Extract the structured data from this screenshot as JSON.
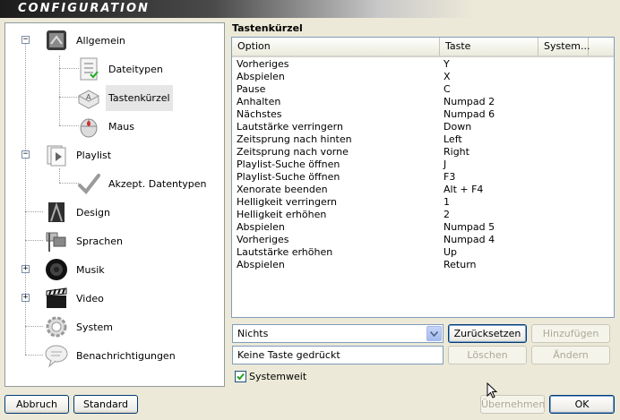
{
  "window": {
    "title": "CONFIGURATION"
  },
  "tree": {
    "items": [
      {
        "label": "Allgemein",
        "icon": "settings-panel-icon",
        "expander": "−"
      },
      {
        "label": "Dateitypen",
        "icon": "file-types-icon"
      },
      {
        "label": "Tastenkürzel",
        "icon": "keyboard-key-icon"
      },
      {
        "label": "Maus",
        "icon": "mouse-icon"
      },
      {
        "label": "Playlist",
        "icon": "playlist-icon",
        "expander": "−"
      },
      {
        "label": "Akzept. Datentypen",
        "icon": "checkmark-icon"
      },
      {
        "label": "Design",
        "icon": "design-icon"
      },
      {
        "label": "Sprachen",
        "icon": "flags-icon"
      },
      {
        "label": "Musik",
        "icon": "speaker-icon",
        "expander": "+"
      },
      {
        "label": "Video",
        "icon": "clapperboard-icon",
        "expander": "+"
      },
      {
        "label": "System",
        "icon": "gear-icon"
      },
      {
        "label": "Benachrichtigungen",
        "icon": "speech-bubble-icon"
      }
    ]
  },
  "panel": {
    "heading": "Tastenkürzel"
  },
  "list": {
    "columns": [
      "Option",
      "Taste",
      "System..."
    ],
    "rows": [
      [
        "Vorheriges",
        "Y"
      ],
      [
        "Abspielen",
        "X"
      ],
      [
        "Pause",
        "C"
      ],
      [
        "Anhalten",
        "Numpad 2"
      ],
      [
        "Nächstes",
        "Numpad 6"
      ],
      [
        "Lautstärke verringern",
        "Down"
      ],
      [
        "Zeitsprung nach hinten",
        "Left"
      ],
      [
        "Zeitsprung nach vorne",
        "Right"
      ],
      [
        "Playlist-Suche öffnen",
        "J"
      ],
      [
        "Playlist-Suche öffnen",
        "F3"
      ],
      [
        "Xenorate beenden",
        "Alt + F4"
      ],
      [
        "Helligkeit verringern",
        "1"
      ],
      [
        "Helligkeit erhöhen",
        "2"
      ],
      [
        "Abspielen",
        "Numpad 5"
      ],
      [
        "Vorheriges",
        "Numpad 4"
      ],
      [
        "Lautstärke erhöhen",
        "Up"
      ],
      [
        "Abspielen",
        "Return"
      ]
    ]
  },
  "controls": {
    "combo_value": "Nichts",
    "key_field": "Keine Taste gedrückt",
    "reset": "Zurücksetzen",
    "add": "Hinzufügen",
    "delete": "Löschen",
    "change": "Ändern",
    "systemwide": "Systemweit"
  },
  "footer": {
    "cancel": "Abbruch",
    "default": "Standard",
    "apply": "Übernehmen",
    "ok": "OK"
  },
  "colors": {
    "accent": "#003c74",
    "selection": "#e6e6e6",
    "check": "#21a121"
  }
}
